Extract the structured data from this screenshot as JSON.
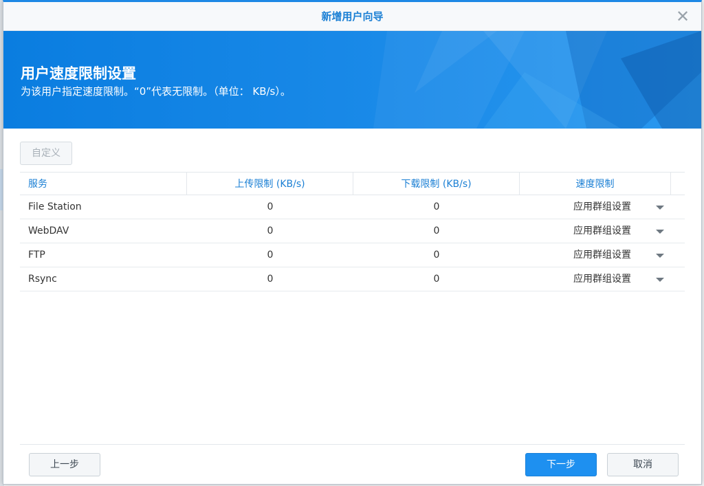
{
  "dialog": {
    "title": "新增用户向导",
    "close_icon": "close-icon"
  },
  "banner": {
    "heading": "用户速度限制设置",
    "description": "为该用户指定速度限制。“0”代表无限制。（单位： KB/s）。"
  },
  "toolbar": {
    "custom_label": "自定义"
  },
  "table": {
    "headers": [
      "服务",
      "上传限制 (KB/s)",
      "下载限制 (KB/s)",
      "速度限制"
    ],
    "rows": [
      {
        "service": "File Station",
        "upload": "0",
        "download": "0",
        "limit": "应用群组设置"
      },
      {
        "service": "WebDAV",
        "upload": "0",
        "download": "0",
        "limit": "应用群组设置"
      },
      {
        "service": "FTP",
        "upload": "0",
        "download": "0",
        "limit": "应用群组设置"
      },
      {
        "service": "Rsync",
        "upload": "0",
        "download": "0",
        "limit": "应用群组设置"
      }
    ]
  },
  "footer": {
    "prev_label": "上一步",
    "next_label": "下一步",
    "cancel_label": "取消"
  },
  "colors": {
    "accent": "#1e90f0",
    "banner": "#0a7de0",
    "header_text": "#1a7fd4"
  }
}
